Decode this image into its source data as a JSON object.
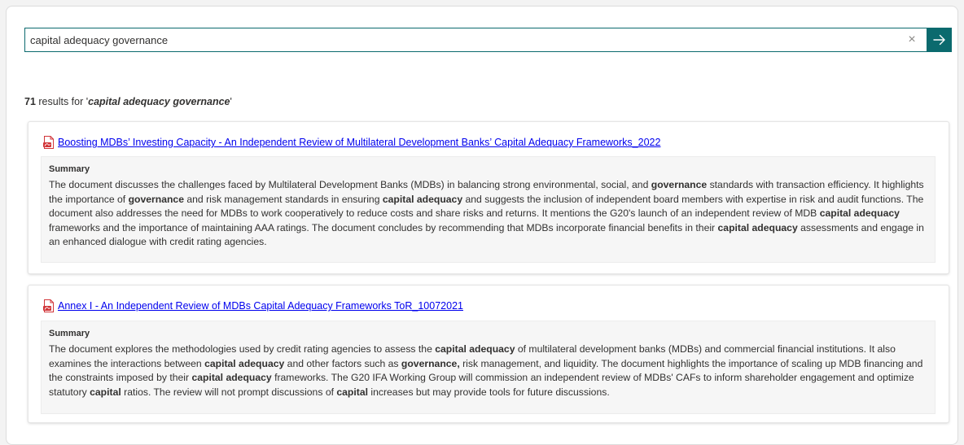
{
  "search": {
    "value": "capital adequacy governance",
    "clear_label": "×",
    "go_icon": "arrow-right-icon"
  },
  "results": {
    "count": "71",
    "prefix": " results for '",
    "query": "capital adequacy governance",
    "suffix": "'"
  },
  "summary_label": "Summary",
  "cards": [
    {
      "title": "Boosting MDBs’ Investing Capacity - An Independent Review of Multilateral Development Banks’ Capital Adequacy Frameworks_2022",
      "icon": "pdf-icon",
      "summary": [
        {
          "t": "The document discusses the challenges faced by Multilateral Development Banks (MDBs) in balancing strong environmental, social, and "
        },
        {
          "t": "governance",
          "b": true
        },
        {
          "t": " standards with transaction efficiency. It highlights the importance of "
        },
        {
          "t": "governance",
          "b": true
        },
        {
          "t": " and risk management standards in ensuring "
        },
        {
          "t": "capital adequacy",
          "b": true
        },
        {
          "t": " and suggests the inclusion of independent board members with expertise in risk and audit functions. The document also addresses the need for MDBs to work cooperatively to reduce costs and share risks and returns. It mentions the G20's launch of an independent review of MDB "
        },
        {
          "t": "capital adequacy",
          "b": true
        },
        {
          "t": " frameworks and the importance of maintaining AAA ratings. The document concludes by recommending that MDBs incorporate financial benefits in their "
        },
        {
          "t": "capital adequacy",
          "b": true
        },
        {
          "t": " assessments and engage in an enhanced dialogue with credit rating agencies."
        }
      ]
    },
    {
      "title": "Annex I - An Independent Review of MDBs Capital Adequacy Frameworks ToR_10072021",
      "icon": "pdf-icon",
      "summary": [
        {
          "t": "The document explores the methodologies used by credit rating agencies to assess the "
        },
        {
          "t": "capital adequacy",
          "b": true
        },
        {
          "t": " of multilateral development banks (MDBs) and commercial financial institutions. It also examines the interactions between "
        },
        {
          "t": "capital adequacy",
          "b": true
        },
        {
          "t": " and other factors such as "
        },
        {
          "t": "governance,",
          "b": true
        },
        {
          "t": " risk management, and liquidity. The document highlights the importance of scaling up MDB financing and the constraints imposed by their "
        },
        {
          "t": "capital adequacy",
          "b": true
        },
        {
          "t": " frameworks. The G20 IFA Working Group will commission an independent review of MDBs' CAFs to inform shareholder engagement and optimize statutory "
        },
        {
          "t": "capital",
          "b": true
        },
        {
          "t": " ratios. The review will not prompt discussions of "
        },
        {
          "t": "capital",
          "b": true
        },
        {
          "t": " increases but may provide tools for future discussions."
        }
      ]
    }
  ],
  "colors": {
    "accent": "#0b6a6e",
    "link": "#0000ee",
    "pdf_red": "#d13438"
  }
}
